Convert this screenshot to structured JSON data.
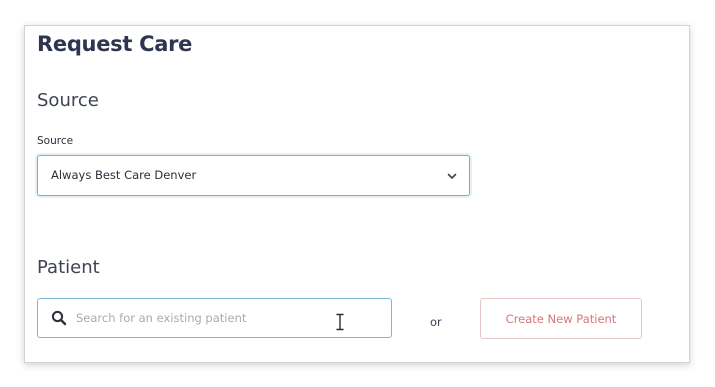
{
  "page": {
    "title": "Request Care"
  },
  "source_section": {
    "heading": "Source",
    "field_label": "Source",
    "selected_value": "Always Best Care Denver",
    "chevron_icon": "chevron-down-icon"
  },
  "patient_section": {
    "heading": "Patient",
    "search": {
      "icon": "search-icon",
      "placeholder": "Search for an existing patient",
      "value": ""
    },
    "separator": "or",
    "create_button_label": "Create New Patient"
  },
  "colors": {
    "title": "#2f3550",
    "focus_border": "#6fb0d4",
    "button_text": "#d8757a",
    "button_border": "#e8c6c6",
    "placeholder": "#a7abb2"
  }
}
